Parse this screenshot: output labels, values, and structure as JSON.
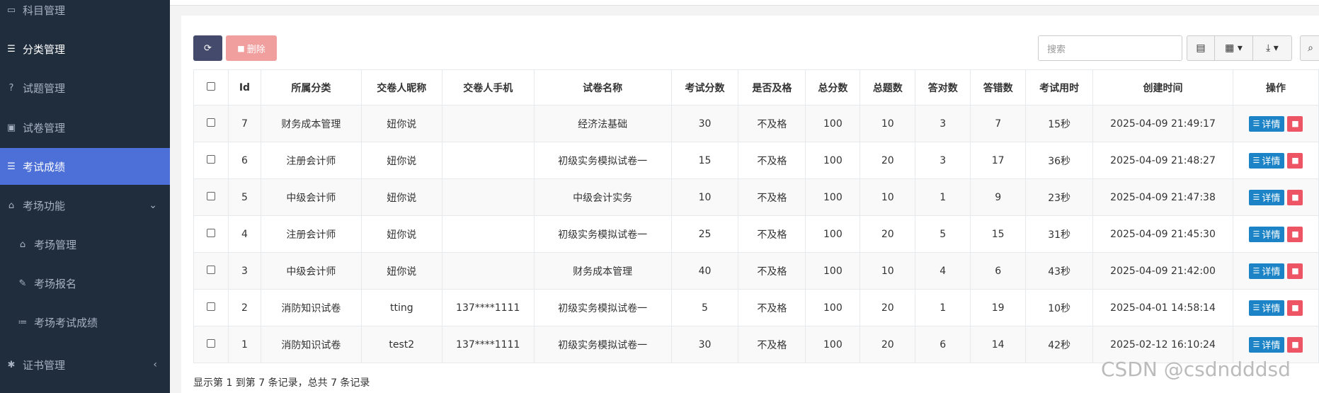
{
  "sidebar": {
    "items": [
      {
        "label": "科目管理",
        "icon": "map-icon"
      },
      {
        "label": "分类管理",
        "icon": "list-icon"
      },
      {
        "label": "试题管理",
        "icon": "question-circle-icon"
      },
      {
        "label": "试卷管理",
        "icon": "id-card-icon"
      },
      {
        "label": "考试成绩",
        "icon": "table-list-icon"
      },
      {
        "label": "考场功能",
        "icon": "home-icon"
      },
      {
        "label": "考场管理",
        "icon": "home-icon"
      },
      {
        "label": "考场报名",
        "icon": "pencil-icon"
      },
      {
        "label": "考场考试成绩",
        "icon": "ordered-list-icon"
      },
      {
        "label": "证书管理",
        "icon": "gear-icon"
      }
    ],
    "active": "考试成绩"
  },
  "toolbar": {
    "delete_label": "删除",
    "search_placeholder": "搜索"
  },
  "table": {
    "headers": [
      "Id",
      "所属分类",
      "交卷人昵称",
      "交卷人手机",
      "试卷名称",
      "考试分数",
      "是否及格",
      "总分数",
      "总题数",
      "答对数",
      "答错数",
      "考试用时",
      "创建时间",
      "操作"
    ],
    "rows": [
      {
        "id": "7",
        "category": "财务成本管理",
        "nickname": "妞你说",
        "phone": "",
        "paper": "经济法基础",
        "score": "30",
        "pass": "不及格",
        "total": "100",
        "questions": "10",
        "correct": "3",
        "wrong": "7",
        "time": "15秒",
        "created": "2025-04-09 21:49:17"
      },
      {
        "id": "6",
        "category": "注册会计师",
        "nickname": "妞你说",
        "phone": "",
        "paper": "初级实务模拟试卷一",
        "score": "15",
        "pass": "不及格",
        "total": "100",
        "questions": "20",
        "correct": "3",
        "wrong": "17",
        "time": "36秒",
        "created": "2025-04-09 21:48:27"
      },
      {
        "id": "5",
        "category": "中级会计师",
        "nickname": "妞你说",
        "phone": "",
        "paper": "中级会计实务",
        "score": "10",
        "pass": "不及格",
        "total": "100",
        "questions": "10",
        "correct": "1",
        "wrong": "9",
        "time": "23秒",
        "created": "2025-04-09 21:47:38"
      },
      {
        "id": "4",
        "category": "注册会计师",
        "nickname": "妞你说",
        "phone": "",
        "paper": "初级实务模拟试卷一",
        "score": "25",
        "pass": "不及格",
        "total": "100",
        "questions": "20",
        "correct": "5",
        "wrong": "15",
        "time": "31秒",
        "created": "2025-04-09 21:45:30"
      },
      {
        "id": "3",
        "category": "中级会计师",
        "nickname": "妞你说",
        "phone": "",
        "paper": "财务成本管理",
        "score": "40",
        "pass": "不及格",
        "total": "100",
        "questions": "10",
        "correct": "4",
        "wrong": "6",
        "time": "43秒",
        "created": "2025-04-09 21:42:00"
      },
      {
        "id": "2",
        "category": "消防知识试卷",
        "nickname": "tting",
        "phone": "137****1111",
        "paper": "初级实务模拟试卷一",
        "score": "5",
        "pass": "不及格",
        "total": "100",
        "questions": "20",
        "correct": "1",
        "wrong": "19",
        "time": "10秒",
        "created": "2025-04-01 14:58:14"
      },
      {
        "id": "1",
        "category": "消防知识试卷",
        "nickname": "test2",
        "phone": "137****1111",
        "paper": "初级实务模拟试卷一",
        "score": "30",
        "pass": "不及格",
        "total": "100",
        "questions": "20",
        "correct": "6",
        "wrong": "14",
        "time": "42秒",
        "created": "2025-02-12 16:10:24"
      }
    ],
    "detail_label": "详情"
  },
  "footer": "显示第 1 到第 7 条记录，总共 7 条记录",
  "watermark": "CSDN @csdndddsd",
  "colors": {
    "sidebar_bg": "#1f2d3d",
    "active_bg": "#4c6fd8",
    "detail_btn": "#1c84c6",
    "delete_btn": "#ed5565"
  }
}
